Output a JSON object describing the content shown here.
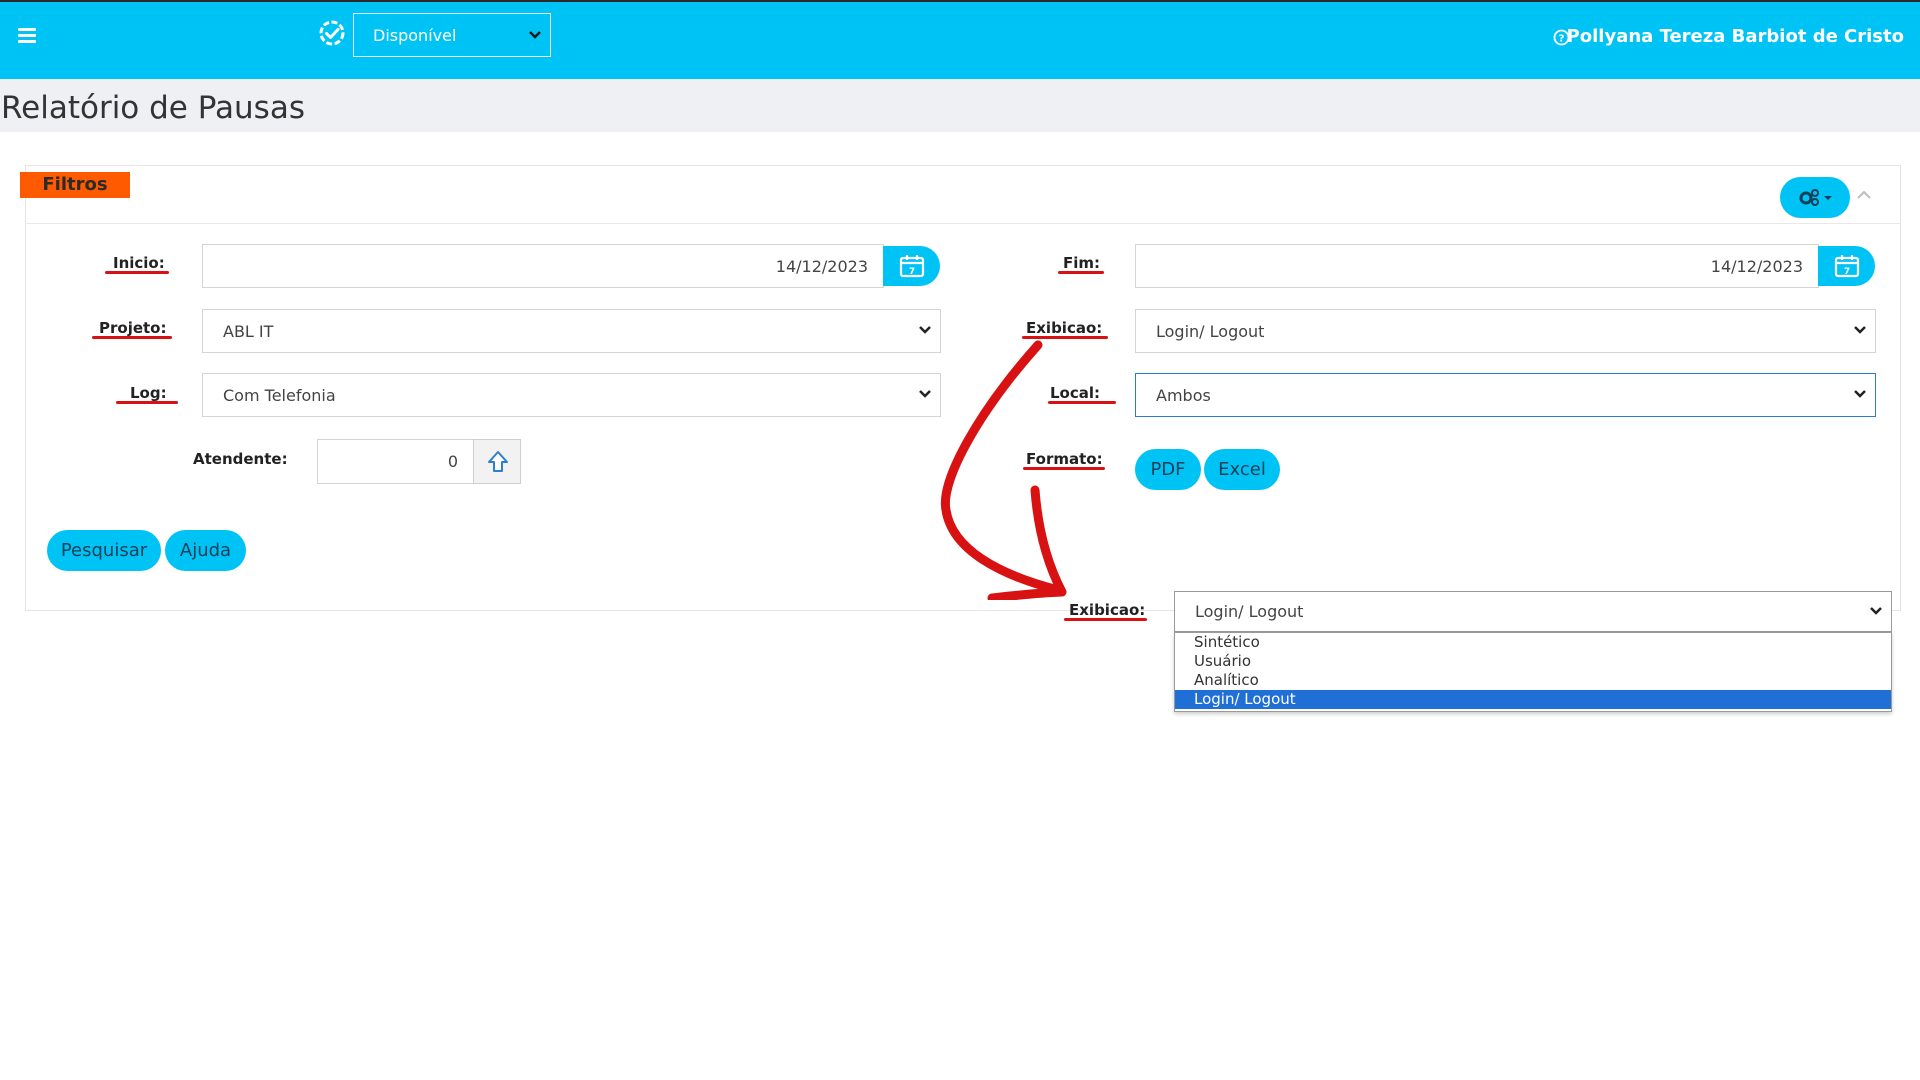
{
  "topbar": {
    "status_value": "Disponível",
    "user_name": "Pollyana Tereza Barbiot de Cristo",
    "bg_color": "#00c3f5"
  },
  "page": {
    "title": "Relatório de Pausas"
  },
  "filters": {
    "tag": "Filtros",
    "inicio_label": "Inicio:",
    "inicio_value": "14/12/2023",
    "fim_label": "Fim:",
    "fim_value": "14/12/2023",
    "projeto_label": "Projeto:",
    "projeto_value": "ABL IT",
    "exibicao_label": "Exibicao:",
    "exibicao_value": "Login/ Logout",
    "log_label": "Log:",
    "log_value": "Com Telefonia",
    "local_label": "Local:",
    "local_value": "Ambos",
    "atendente_label": "Atendente:",
    "atendente_value": "0",
    "formato_label": "Formato:",
    "pdf_label": "PDF",
    "excel_label": "Excel",
    "pesquisar_label": "Pesquisar",
    "ajuda_label": "Ajuda"
  },
  "zoom_dropdown": {
    "label": "Exibicao:",
    "value": "Login/ Logout",
    "options": [
      "Sintético",
      "Usuário",
      "Analítico",
      "Login/ Logout"
    ],
    "selected_index": 3
  },
  "icons": {
    "menu": "hamburger-icon",
    "status": "check-circle-icon",
    "help": "question-circle-icon",
    "settings": "gears-icon",
    "collapse": "chevron-up-icon",
    "calendar": "calendar-icon",
    "upload": "arrow-up-icon"
  },
  "colors": {
    "accent": "#00c3f5",
    "tag": "#ff5a00",
    "annotation": "#d81212",
    "selected_option": "#1f6fd6"
  }
}
